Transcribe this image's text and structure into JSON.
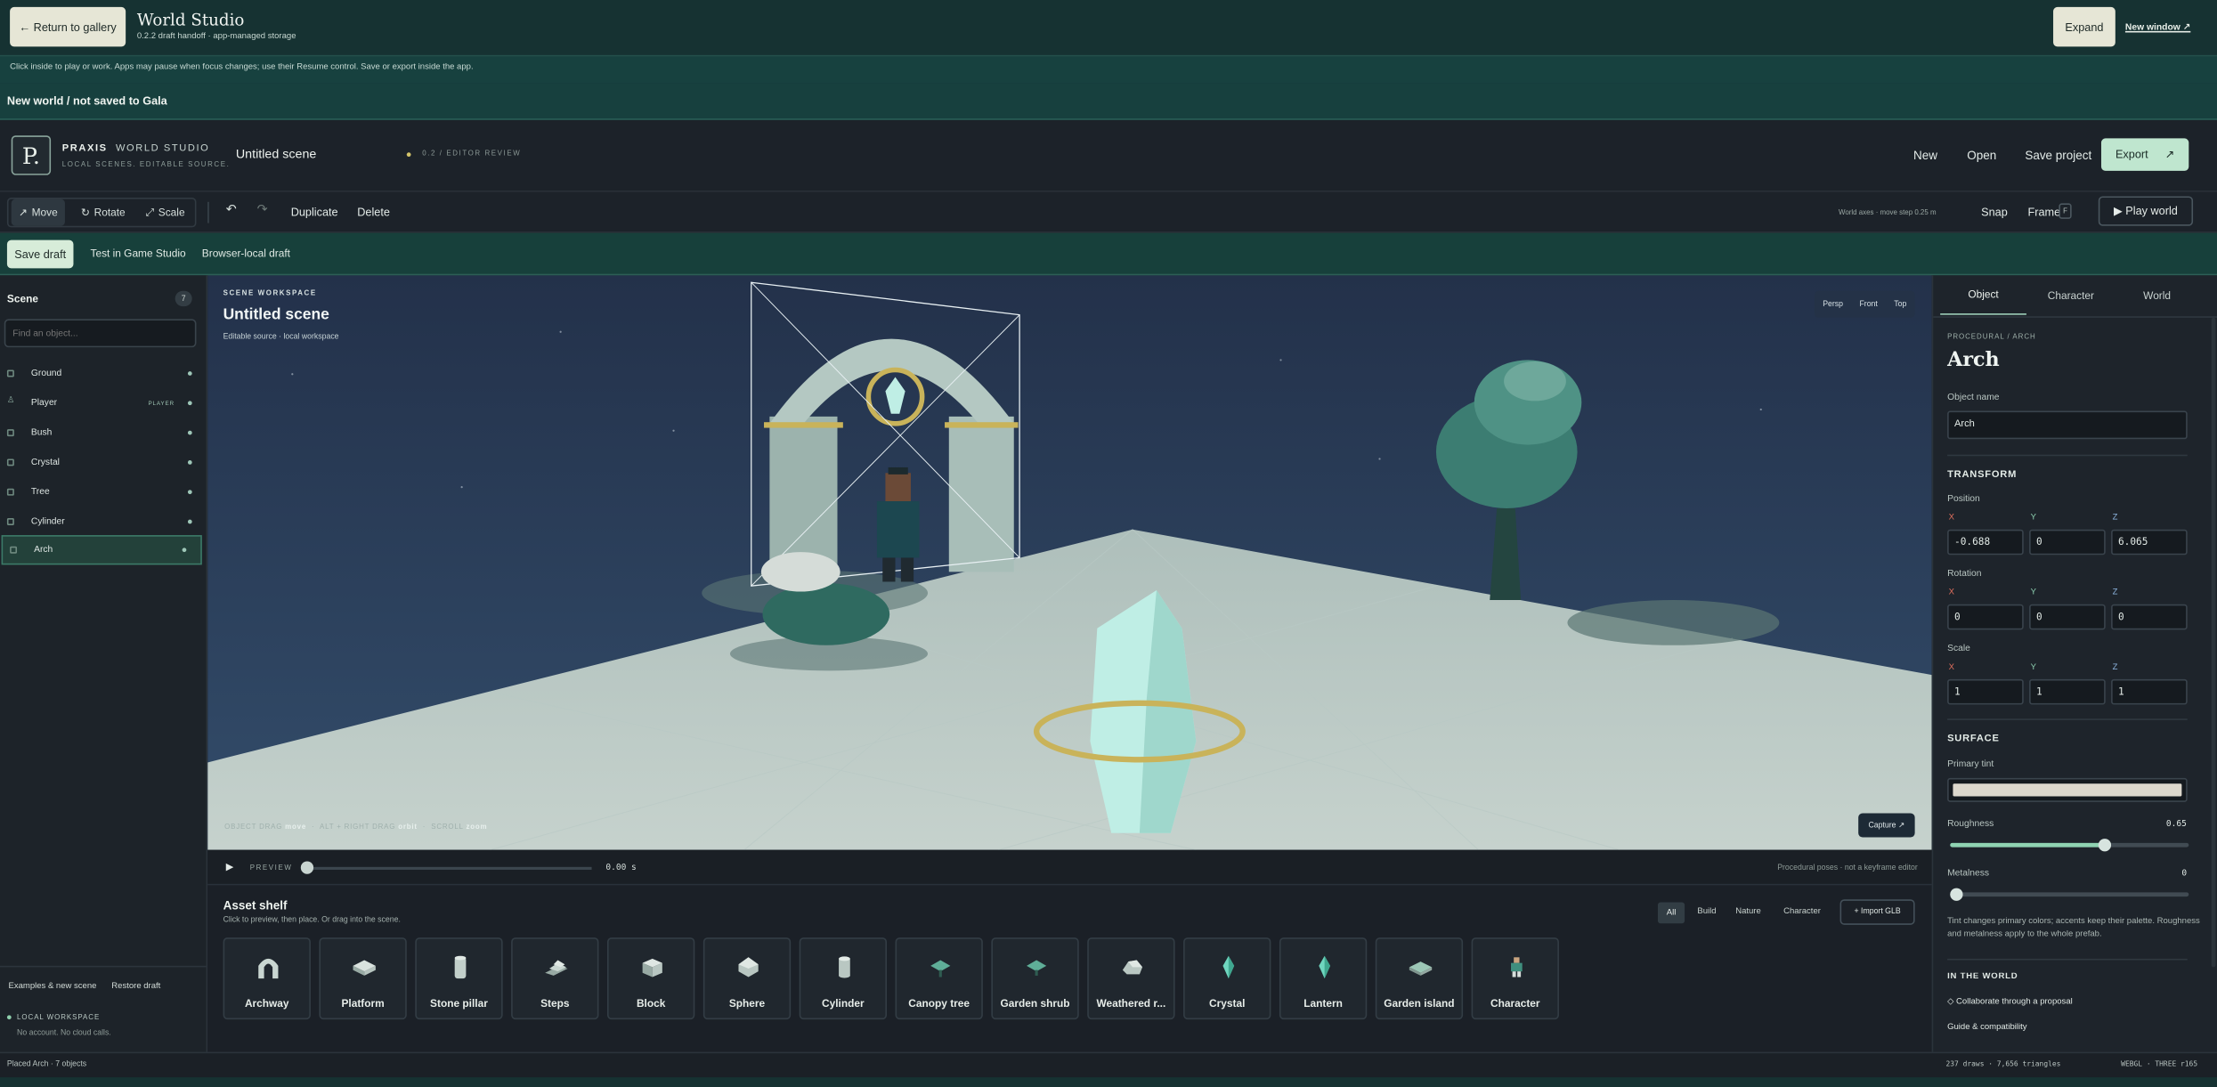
{
  "host": {
    "back": "← Return to gallery",
    "title": "World Studio",
    "subtitle": "0.2.2 draft handoff · app-managed storage",
    "expand": "Expand",
    "new_window": "New window ↗",
    "hint": "Click inside to play or work. Apps may pause when focus changes; use their Resume control. Save or export inside the app.",
    "status": "New world / not saved to Gala"
  },
  "brand": {
    "mark": "P.",
    "name": "PRAXIS",
    "name2": "WORLD STUDIO",
    "tag": "LOCAL SCENES. EDITABLE SOURCE.",
    "scene": "Untitled scene",
    "review": "0.2 / EDITOR REVIEW"
  },
  "menu": {
    "new": "New",
    "open": "Open",
    "save": "Save project",
    "export": "Export"
  },
  "tools": {
    "move": "Move",
    "rotate": "Rotate",
    "scale": "Scale",
    "undo": "↶",
    "redo": "↷",
    "duplicate": "Duplicate",
    "delete": "Delete",
    "axes": "World axes · move step 0.25 m",
    "snap": "Snap",
    "frame": "Frame",
    "frame_key": "F",
    "play": "▶ Play world"
  },
  "draft": {
    "save": "Save draft",
    "test": "Test in Game Studio",
    "local": "Browser-local draft"
  },
  "scene": {
    "title": "Scene",
    "count": "7",
    "search_placeholder": "Find an object...",
    "items": [
      {
        "name": "Ground",
        "tag": ""
      },
      {
        "name": "Player",
        "tag": "PLAYER"
      },
      {
        "name": "Bush",
        "tag": ""
      },
      {
        "name": "Crystal",
        "tag": ""
      },
      {
        "name": "Tree",
        "tag": ""
      },
      {
        "name": "Cylinder",
        "tag": ""
      },
      {
        "name": "Arch",
        "tag": ""
      }
    ],
    "examples": "Examples & new scene",
    "restore": "Restore draft",
    "ws": "LOCAL WORKSPACE",
    "ws_sub": "No account. No cloud calls."
  },
  "viewport": {
    "kicker": "SCENE WORKSPACE",
    "title": "Untitled scene",
    "sub": "Editable source · local workspace",
    "views": [
      "Persp",
      "Front",
      "Top"
    ],
    "capture": "Capture ↗",
    "hint1": "OBJECT DRAG",
    "hint1v": "move",
    "hint2": "ALT + RIGHT DRAG",
    "hint2v": "orbit",
    "hint3": "SCROLL",
    "hint3v": "zoom"
  },
  "timeline": {
    "label": "PREVIEW",
    "time": "0.00 s",
    "note": "Procedural poses · not a keyframe editor",
    "progress": 0
  },
  "shelf": {
    "title": "Asset shelf",
    "sub": "Click to preview, then place. Or drag into the scene.",
    "filters": [
      "All",
      "Build",
      "Nature",
      "Character"
    ],
    "import": "+ Import GLB",
    "assets": [
      "Archway",
      "Platform",
      "Stone pillar",
      "Steps",
      "Block",
      "Sphere",
      "Cylinder",
      "Canopy tree",
      "Garden shrub",
      "Weathered r...",
      "Crystal",
      "Lantern",
      "Garden island",
      "Character"
    ]
  },
  "inspector": {
    "tabs": [
      "Object",
      "Character",
      "World"
    ],
    "kicker": "PROCEDURAL / ARCH",
    "title": "Arch",
    "name_label": "Object name",
    "name": "Arch",
    "transform": "TRANSFORM",
    "position": "Position",
    "rotation": "Rotation",
    "scale": "Scale",
    "x": "X",
    "y": "Y",
    "z": "Z",
    "pos": [
      "-0.688",
      "0",
      "6.065"
    ],
    "rot": [
      "0",
      "0",
      "0"
    ],
    "scl": [
      "1",
      "1",
      "1"
    ],
    "surface": "SURFACE",
    "tint": "Primary tint",
    "roughness": "Roughness",
    "roughness_val": "0.65",
    "metalness": "Metalness",
    "metalness_val": "0",
    "note": "Tint changes primary colors; accents keep their palette. Roughness and metalness apply to the whole prefab.",
    "in_world": "IN THE WORLD",
    "collab": "◇ Collaborate through a proposal",
    "guide": "Guide & compatibility"
  },
  "footer": {
    "left": "Placed Arch · 7 objects",
    "stats": "237 draws · 7,656 triangles",
    "engine": "WEBGL · THREE r165"
  },
  "colors": {
    "accent": "#bfe6cf",
    "teal": "#17403b"
  }
}
